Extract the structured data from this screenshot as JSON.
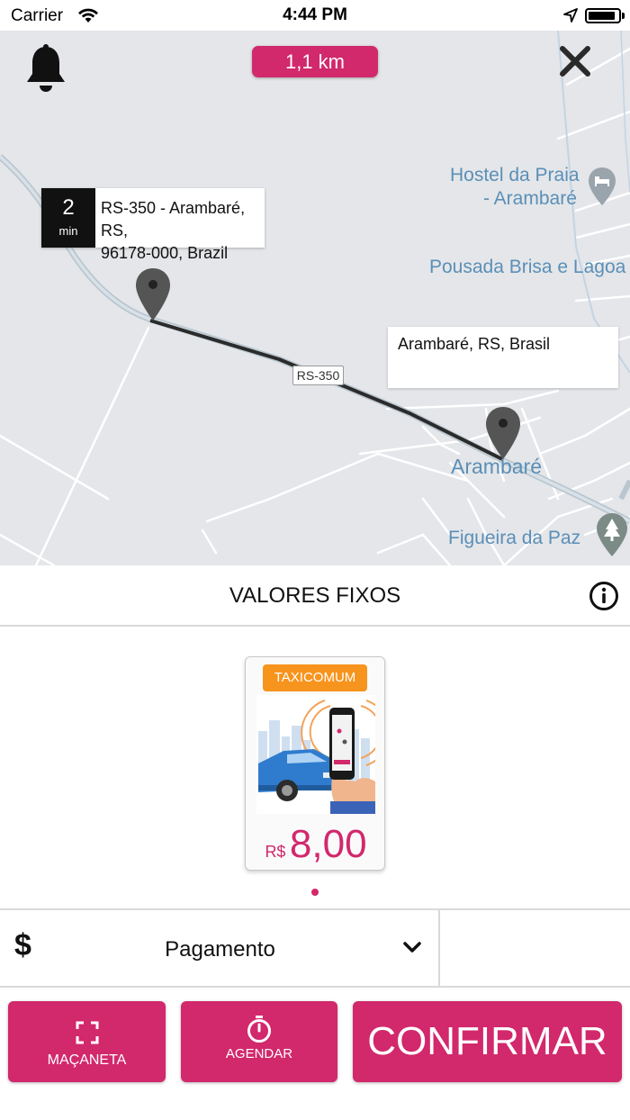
{
  "status_bar": {
    "carrier": "Carrier",
    "time": "4:44 PM",
    "battery_level": 0.9
  },
  "map": {
    "distance": "1,1 km",
    "origin": {
      "eta_value": "2",
      "eta_unit": "min",
      "address_line1": "RS-350 - Arambaré, RS,",
      "address_line2": "96178-000, Brazil"
    },
    "destination": {
      "address": "Arambaré, RS, Brasil"
    },
    "road_shield": "RS-350",
    "places": {
      "hostel_line1": "Hostel da Praia",
      "hostel_line2": "- Arambaré",
      "pousada": "Pousada Brisa e Lagoa",
      "city": "Arambaré",
      "figueira": "Figueira da Paz"
    }
  },
  "section": {
    "title": "VALORES FIXOS"
  },
  "vehicle": {
    "category": "TAXICOMUM",
    "currency": "R$",
    "price": "8,00"
  },
  "payment": {
    "label": "Pagamento"
  },
  "actions": {
    "macaneta": "MAÇANETA",
    "agendar": "AGENDAR",
    "confirmar": "CONFIRMAR"
  },
  "colors": {
    "accent": "#d2286c",
    "tag": "#f7941d",
    "map_bg": "#e4e6e9",
    "map_label": "#5b8fb7"
  },
  "icons": [
    "bell-icon",
    "close-icon",
    "map-pin-icon",
    "info-icon",
    "dollar-icon",
    "chevron-down-icon",
    "scan-icon",
    "stopwatch-icon"
  ]
}
